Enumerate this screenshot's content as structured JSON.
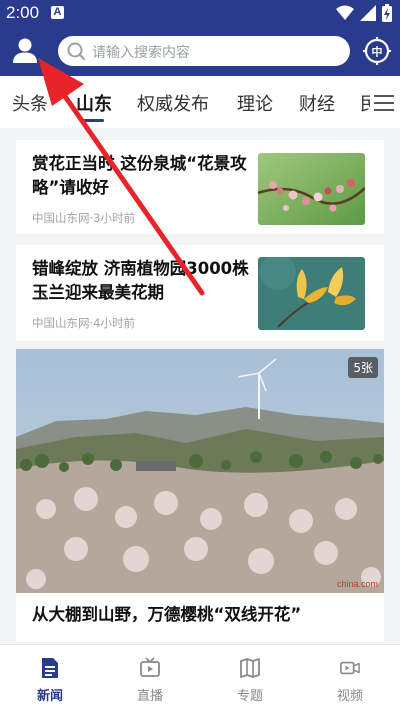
{
  "status_bar": {
    "time": "2:00",
    "notification_badge": "A"
  },
  "header": {
    "search_placeholder": "请输入搜索内容",
    "scan_icon_label": "中"
  },
  "tabs": [
    {
      "label": "头条"
    },
    {
      "label": "山东",
      "active": true
    },
    {
      "label": "权威发布"
    },
    {
      "label": "理论"
    },
    {
      "label": "财经"
    },
    {
      "label": "民"
    }
  ],
  "articles": [
    {
      "title": "赏花正当时 这份泉城“花景攻略”请收好",
      "meta": "中国山东网·3小时前"
    },
    {
      "title": "错峰绽放 济南植物园3000株玉兰迎来最美花期",
      "meta": "中国山东网·4小时前"
    }
  ],
  "feature": {
    "title": "从大棚到山野，万德樱桃“双线开花”",
    "image_count": "5张",
    "watermark": "china.com"
  },
  "bottom_nav": [
    {
      "label": "新闻",
      "icon": "news-icon",
      "active": true
    },
    {
      "label": "直播",
      "icon": "live-tv-icon"
    },
    {
      "label": "专题",
      "icon": "topic-map-icon"
    },
    {
      "label": "视频",
      "icon": "video-camera-icon"
    }
  ],
  "colors": {
    "brand": "#2a3a8c",
    "annotation_arrow": "#e8232a"
  }
}
